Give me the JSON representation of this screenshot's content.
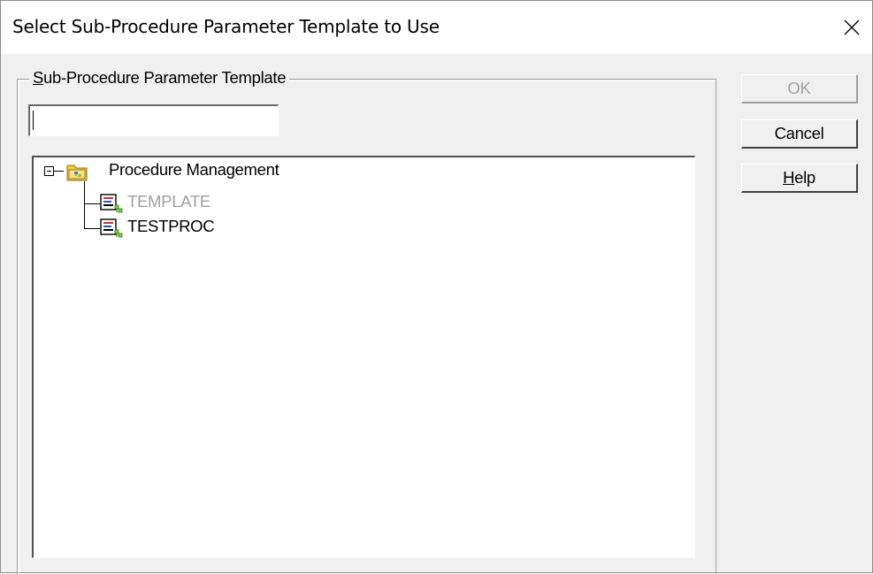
{
  "dialog": {
    "title": "Select Sub-Procedure Parameter Template to Use",
    "close_glyph": "✕"
  },
  "group": {
    "label_accel": "S",
    "label_rest": "ub-Procedure Parameter Template"
  },
  "search": {
    "value": ""
  },
  "tree": {
    "root": {
      "label": "Procedure Management",
      "expanded": true,
      "icon": "folder-icon"
    },
    "children": [
      {
        "label": "TEMPLATE",
        "state": "disabled",
        "icon": "procedure-icon"
      },
      {
        "label": "TESTPROC",
        "state": "normal",
        "icon": "procedure-icon"
      }
    ]
  },
  "buttons": {
    "ok": "OK",
    "cancel": "Cancel",
    "help_accel": "H",
    "help_rest": "elp"
  },
  "colors": {
    "dialog_bg": "#f0f0f0",
    "disabled_text": "#a0a0a0",
    "folder_yellow": "#f5c93a",
    "icon_green": "#7fd13b"
  }
}
